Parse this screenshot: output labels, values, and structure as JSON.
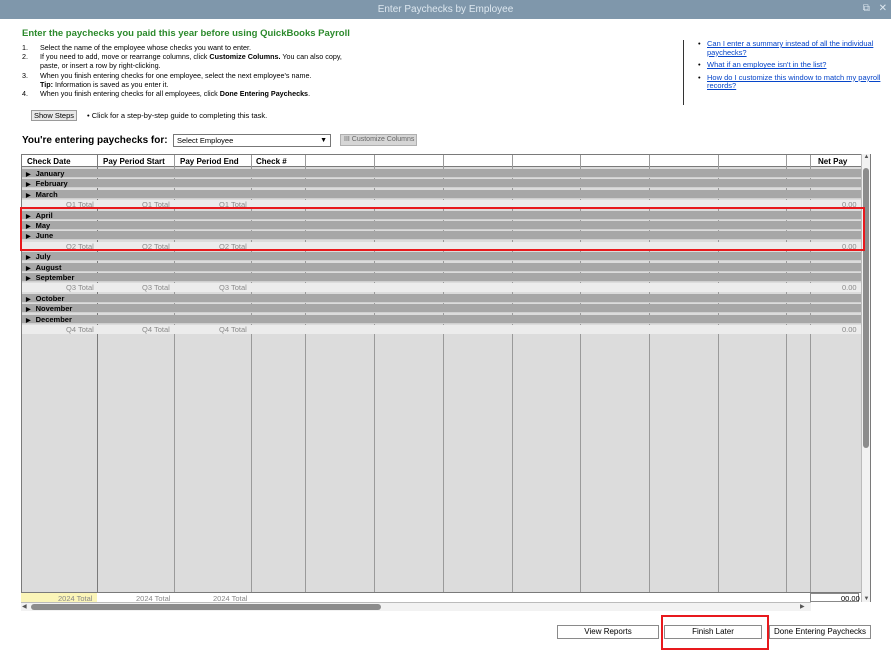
{
  "window": {
    "title": "Enter Paychecks by Employee",
    "restore_icon": "restore-icon",
    "close_icon": "close-icon"
  },
  "header": "Enter the paychecks you paid this year before using QuickBooks Payroll",
  "steps": [
    {
      "num": "1.",
      "text": "Select the name of the employee whose checks you want to enter."
    },
    {
      "num": "2.",
      "pre": "If you need to add, move or rearrange columns, click ",
      "bold": "Customize Columns.",
      "post": " You can also copy, paste, or insert a row by right-clicking."
    },
    {
      "num": "3.",
      "text": "When you finish entering checks for one employee, select the next employee's name.",
      "tip_label": "Tip:",
      "tip": " Information is saved as you enter it."
    },
    {
      "num": "4.",
      "pre": "When you finish entering checks for all employees, click ",
      "bold": "Done Entering Paychecks",
      "post": "."
    }
  ],
  "show_steps": {
    "label": "Show Steps",
    "desc": "•  Click for a step-by-step guide to completing this task."
  },
  "help_links": [
    "Can I enter a summary instead of all the individual paychecks?",
    "What if an employee isn't in the list?",
    "How do I customize this window to match my payroll records?"
  ],
  "entering_label": "You're entering paychecks for:",
  "employee_select": {
    "value": "Select Employee"
  },
  "customize_columns": "III Customize Columns",
  "columns": [
    "Check Date",
    "Pay Period Start",
    "Pay Period End",
    "Check #",
    "Net Pay"
  ],
  "quarters": [
    {
      "months": [
        "January",
        "February",
        "March"
      ],
      "total": "Q1 Total",
      "net": "0.00"
    },
    {
      "months": [
        "April",
        "May",
        "June"
      ],
      "total": "Q2 Total",
      "net": "0.00"
    },
    {
      "months": [
        "July",
        "August",
        "September"
      ],
      "total": "Q3 Total",
      "net": "0.00"
    },
    {
      "months": [
        "October",
        "November",
        "December"
      ],
      "total": "Q4 Total",
      "net": "0.00"
    }
  ],
  "year_total": {
    "label": "2024 Total",
    "net": "00.00"
  },
  "buttons": {
    "view_reports": "View Reports",
    "finish_later": "Finish Later",
    "done": "Done Entering Paychecks"
  },
  "highlight_color": "#e8191d"
}
